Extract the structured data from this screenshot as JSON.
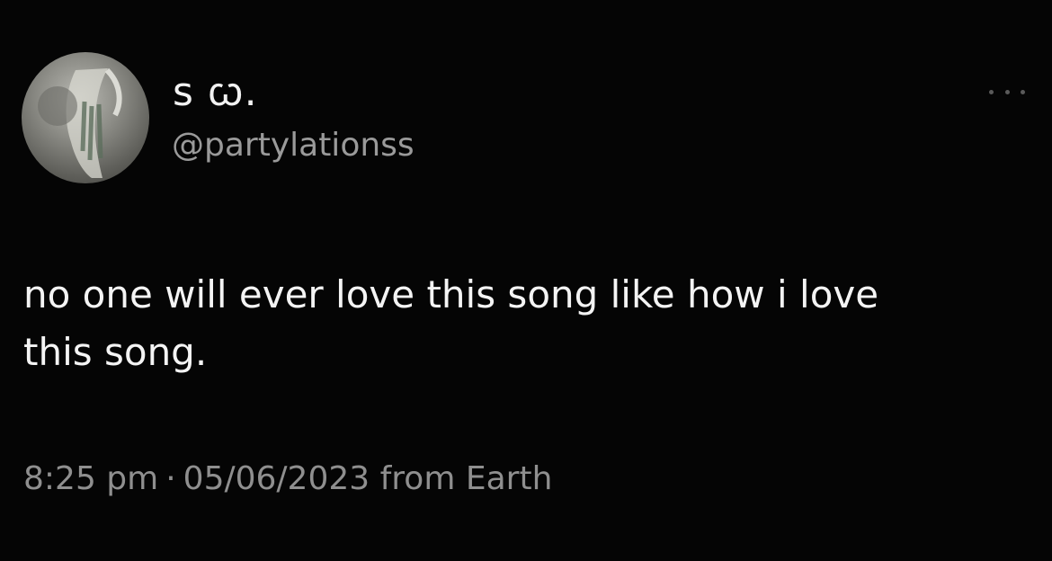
{
  "tweet": {
    "display_name": "s ꞷ.",
    "handle": "@partylationss",
    "text_line1": "no one will ever love this song like how i love",
    "text_line2": "this song.",
    "time": "8:25 pm",
    "separator": "·",
    "date": "05/06/2023",
    "source": "from Earth",
    "more_icon": "ellipsis-icon"
  },
  "colors": {
    "background": "#000000",
    "text_primary": "#f4f4f4",
    "text_secondary": "#9a9a9a"
  }
}
